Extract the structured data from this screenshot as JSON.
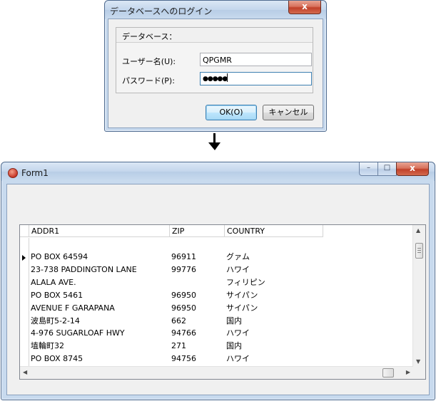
{
  "login_dialog": {
    "title": "データベースへのログイン",
    "close_glyph": "x",
    "database_label": "データベース：",
    "username_label": "ユーザー名(U):",
    "username_value": "QPGMR",
    "password_label": "パスワード(P):",
    "password_value": "●●●●●",
    "ok_label": "OK(O)",
    "cancel_label": "キャンセル"
  },
  "form1": {
    "title": "Form1",
    "icon": "app-icon",
    "minimize_glyph": "–",
    "maximize_glyph": "□",
    "close_glyph": "x",
    "grid": {
      "columns": [
        "ADDR1",
        "ZIP",
        "COUNTRY"
      ],
      "rows": [
        {
          "addr": "PO BOX 64594",
          "zip": "96911",
          "country": "グァム"
        },
        {
          "addr": "23-738 PADDINGTON LANE",
          "zip": "99776",
          "country": "ハワイ"
        },
        {
          "addr": "ALALA AVE.",
          "zip": "",
          "country": "フィリピン"
        },
        {
          "addr": "PO BOX 5461",
          "zip": "96950",
          "country": "サイパン"
        },
        {
          "addr": "AVENUE F GARAPANA",
          "zip": "96950",
          "country": "サイパン"
        },
        {
          "addr": "波島町5-2-14",
          "zip": "662",
          "country": "国内"
        },
        {
          "addr": "4-976 SUGARLOAF HWY",
          "zip": "94766",
          "country": "ハワイ"
        },
        {
          "addr": "埴輪町32",
          "zip": "271",
          "country": "国内"
        },
        {
          "addr": "PO BOX 8745",
          "zip": "94756",
          "country": "ハワイ"
        }
      ]
    }
  },
  "colors": {
    "titlebar": "#c3d6ec",
    "close_button": "#c1412a",
    "client_bg": "#f0f0f0",
    "focus_border": "#3c7fb1"
  }
}
